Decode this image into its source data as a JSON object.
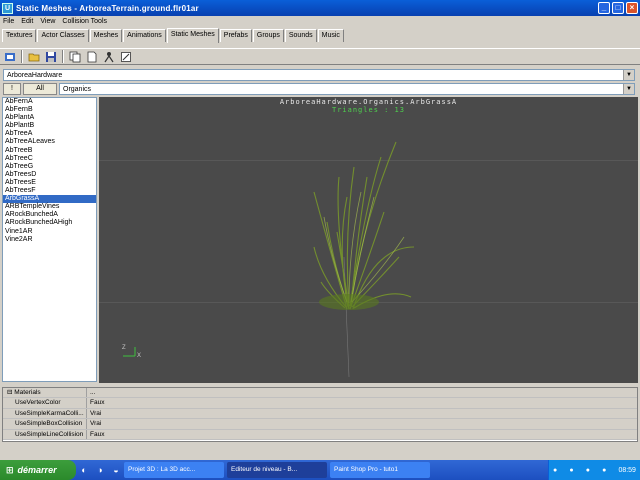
{
  "window": {
    "title": "Static Meshes - ArboreaTerrain.ground.flr01ar",
    "minimize_glyph": "_",
    "maximize_glyph": "□",
    "close_glyph": "×"
  },
  "menu": [
    "File",
    "Edit",
    "View",
    "Collision Tools"
  ],
  "tabs": [
    "Textures",
    "Actor Classes",
    "Meshes",
    "Animations",
    "Static Meshes",
    "Prefabs",
    "Groups",
    "Sounds",
    "Music"
  ],
  "active_tab_index": 4,
  "toolbar": {
    "icons": [
      "import-icon",
      "open-icon",
      "save-icon",
      "copy-icon",
      "new-icon",
      "properties-icon",
      "collision-icon"
    ]
  },
  "package_combo": {
    "value": "ArboreaHardware",
    "arrow": "▼"
  },
  "filter_bar": {
    "button_1": "!",
    "button_all": "All",
    "group_combo": "Organics",
    "arrow": "▼"
  },
  "mesh_list": {
    "items": [
      "AbFernA",
      "AbFernB",
      "AbPlantA",
      "AbPlantB",
      "AbTreeA",
      "AbTreeALeaves",
      "AbTreeB",
      "AbTreeC",
      "AbTreeG",
      "AbTreesD",
      "AbTreesE",
      "AbTreesF",
      "ArbGrassA",
      "ARBTempleVines",
      "ARockBunchedA",
      "ARockBunchedAHigh",
      "Vine1AR",
      "Vine2AR"
    ],
    "selected_index": 12
  },
  "viewport": {
    "mesh_name": "ArboreaHardware.Organics.ArbGrassA",
    "triangles": "Triangles : 13",
    "axis_z": "Z",
    "axis_x": "X",
    "background": "#4a4a4a",
    "grass_color": "#7a9a2a"
  },
  "properties": {
    "expander": "⊟",
    "rows": [
      {
        "key": "Materials",
        "value": "...",
        "group": true
      },
      {
        "key": "UseVertexColor",
        "value": "Faux"
      },
      {
        "key": "UseSimpleKarmaColli...",
        "value": "Vrai"
      },
      {
        "key": "UseSimpleBoxCollision",
        "value": "Vrai"
      },
      {
        "key": "UseSimpleLineCollision",
        "value": "Faux"
      }
    ]
  },
  "taskbar": {
    "start_label": "démarrer",
    "quick_launch": [
      "◐",
      "◑",
      "◒"
    ],
    "tasks": [
      {
        "label": "Projet 3D : La 3D acc...",
        "active": false
      },
      {
        "label": "Editeur de niveau - B...",
        "active": true
      },
      {
        "label": "Paint Shop Pro - tuto1",
        "active": false
      }
    ],
    "clock": "08:59",
    "tray_icons": [
      "●",
      "●",
      "●",
      "●"
    ]
  },
  "accent": "#316ac5"
}
